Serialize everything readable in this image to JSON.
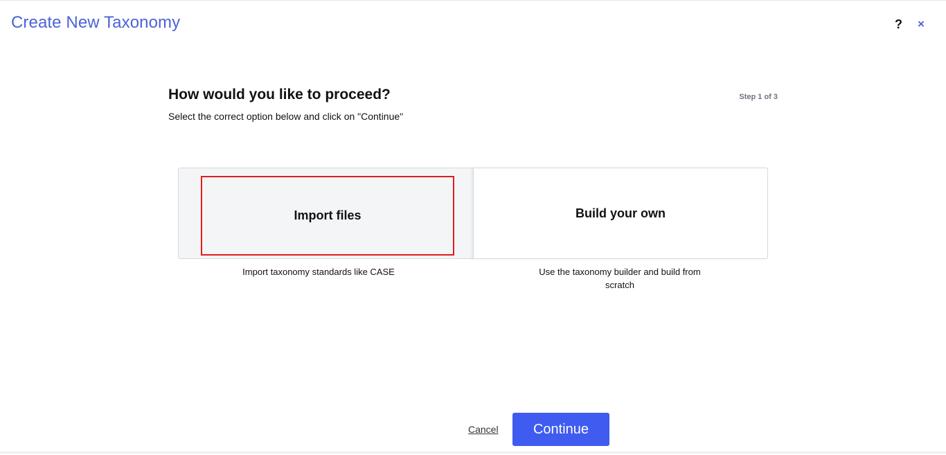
{
  "modal": {
    "title": "Create New Taxonomy",
    "help_label": "?",
    "close_label": "×"
  },
  "wizard": {
    "heading": "How would you like to proceed?",
    "step": "Step 1 of 3",
    "instructions": "Select the correct option below and click on \"Continue\""
  },
  "options": [
    {
      "label": "Import files",
      "description": "Import taxonomy standards like CASE",
      "selected": true
    },
    {
      "label": "Build your own",
      "description": "Use the taxonomy builder and build from scratch",
      "selected": false
    }
  ],
  "footer": {
    "cancel_label": "Cancel",
    "continue_label": "Continue"
  },
  "colors": {
    "accent": "#3f5bf0",
    "title": "#4a63d8",
    "selection_outline": "#e31b1b"
  }
}
